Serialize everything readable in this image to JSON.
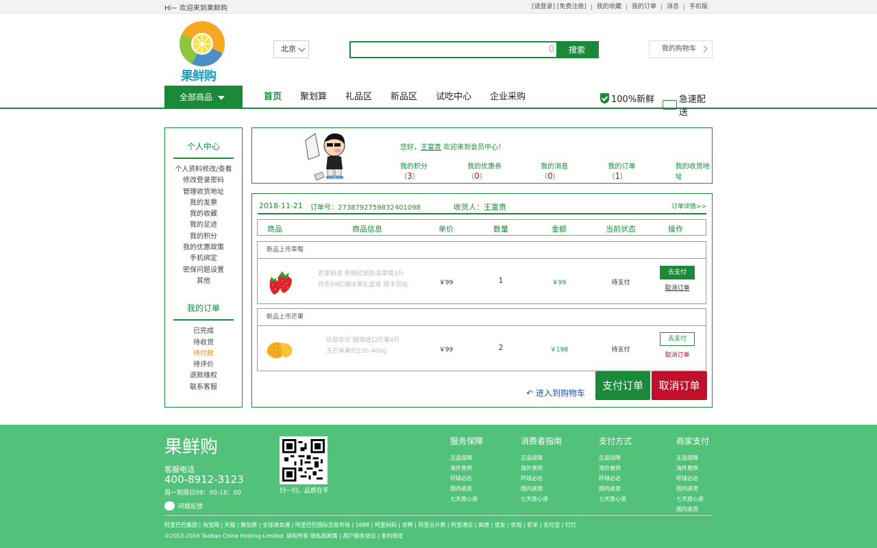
{
  "topbar": {
    "welcome": "Hi~ 欢迎来到果鲜购",
    "links": [
      "[请登录] [免费注册]",
      "我的收藏",
      "我的订单",
      "消息",
      "手机版"
    ]
  },
  "header": {
    "logo_text": "果鲜购",
    "city": "北京",
    "search_placeholder": "",
    "search_button": "搜索",
    "cart": "我的购物车"
  },
  "nav": {
    "all_categories": "全部商品",
    "items": [
      "首页",
      "聚划算",
      "礼品区",
      "新品区",
      "试吃中心",
      "企业采购"
    ],
    "feature1": "100%新鲜",
    "feature2": "急速配送"
  },
  "sidebar": {
    "section1_title": "个人中心",
    "section1_items": [
      "个人资料修改/查看",
      "修改登录密码",
      "管理收货地址",
      "我的发票",
      "我的收藏",
      "我的足迹",
      "我的积分",
      "我的优惠政策",
      "手机绑定",
      "密保问题设置",
      "其他"
    ],
    "section2_title": "我的订单",
    "section2_items": [
      "已完成",
      "待收货",
      "待付款",
      "待评价",
      "退款维权",
      "联系客服"
    ]
  },
  "welcome": {
    "greeting_prefix": "您好，",
    "username": "王富贵",
    "greeting_suffix": " 欢迎来到会员中心！",
    "stats": [
      {
        "label": "我的积分（",
        "value": "3",
        "suffix": "）"
      },
      {
        "label": "我的优惠券（",
        "value": "0",
        "suffix": "）"
      },
      {
        "label": "我的消息（",
        "value": "0",
        "suffix": "）"
      },
      {
        "label": "我的订单（",
        "value": "1",
        "suffix": "）"
      },
      {
        "label": "我的收货地址",
        "value": "",
        "suffix": ""
      }
    ]
  },
  "order": {
    "date": "2018-11-21",
    "order_no": "订单号：2738792759832401098",
    "receiver": "收货人：王富贵",
    "detail_link": "订单详情>>",
    "columns": [
      "商品",
      "商品信息",
      "单价",
      "数量",
      "金额",
      "当前状态",
      "操作"
    ],
    "items": [
      {
        "category": "新品上市草莓",
        "desc_line1": "农家新语 新鲜红颜奶油草莓3斤",
        "desc_line2": "丹东99虹摘冰果礼盒装 顺丰空运",
        "price": "￥99",
        "qty": "1",
        "amount": "￥99",
        "status": "待支付",
        "pay": "去支付",
        "cancel": "取消订单"
      },
      {
        "category": "新品上市芒果",
        "desc_line1": "玖原农珍 越南进口芒果4斤",
        "desc_line2": "玉芒单果约230-400g",
        "price": "￥99",
        "qty": "2",
        "amount": "￥198",
        "status": "待支付",
        "pay": "去支付",
        "cancel": "取消订单"
      }
    ],
    "back_to_cart": "进入到购物车",
    "pay_order": "支付订单",
    "cancel_order": "取消订单"
  },
  "footer": {
    "brand": "果鲜购",
    "tel_label": "客服电话",
    "tel": "400-8912-3123",
    "hours": "周一到周日09：00-18：00",
    "feedback": "问题反馈",
    "qr_text": "扫一扫，品质在手",
    "columns": [
      {
        "title": "服务保障",
        "items": [
          "正品保障",
          "海外直供",
          "环球必达",
          "国内退货",
          "七天放心退"
        ]
      },
      {
        "title": "消费者指南",
        "items": [
          "正品保障",
          "海外直供",
          "环球必达",
          "国内退货",
          "七天放心退"
        ]
      },
      {
        "title": "支付方式",
        "items": [
          "正品保障",
          "海外直供",
          "环球必达",
          "国内退货",
          "七天放心退"
        ]
      },
      {
        "title": "商家支付",
        "items": [
          "正品保障",
          "海外直供",
          "环球必达",
          "国内退货",
          "七天放心退",
          "国内退货"
        ]
      }
    ],
    "links": "阿里巴巴集团 | 淘宝网 | 天猫 | 聚划算 | 全球速卖通 | 阿里巴巴国际交易市场 | 1688 | 阿里妈妈 | 去啊 | 阿里云计算 | 阿里通信 | 高德 | 堂友 | 优视 | 虾米 | 支付宝 | 钉钉",
    "copyright": "©2013-2016 Taobao China Holding Limited. 版权所有 隐私权政策 | 用户服务协议 | 条约规定"
  },
  "colors": {
    "brand_green": "#1a8a3a",
    "footer_green": "#52c27a",
    "cancel_red": "#c0102a"
  }
}
